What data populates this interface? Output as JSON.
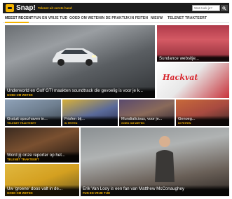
{
  "header": {
    "brand": "Snap!",
    "tagline": "Telenet uit eerste hand",
    "search_placeholder": "Wat zoek je?"
  },
  "nav": {
    "items": [
      {
        "label": "MEEST RECENT",
        "active": true
      },
      {
        "label": "FUN EN VRIJE TIJD",
        "active": false
      },
      {
        "label": "GOED OM WETEN",
        "active": false
      },
      {
        "label": "IN DE PRAKTIJK",
        "active": false
      },
      {
        "label": "IN FEITEN",
        "active": false
      },
      {
        "label": "NIEUW",
        "active": false
      },
      {
        "label": "TELENET TRAKTEERT",
        "active": false
      }
    ]
  },
  "tiles": [
    {
      "title": "Underworld en Golf GTI maakten soundtrack die gevoelig is voor je k...",
      "category": "GOED OM WETEN"
    },
    {
      "title": "Sundance websitje...",
      "category": ""
    },
    {
      "title": "",
      "category": "",
      "logo_text": "Hackvat"
    },
    {
      "title": "Gratuit opscrhaven in...",
      "category": "TELENET TRAKTEERT"
    },
    {
      "title": "Frisfen bij...",
      "category": "IN FEITEN"
    },
    {
      "title": "Mundialicious, voor je...",
      "category": "GOED OM WETEN"
    },
    {
      "title": "Genoeg...",
      "category": "IN FEITEN"
    },
    {
      "title": "Word jij onze reporter op het...",
      "category": "TELENET TRAKTEERT"
    },
    {
      "title": "Erik Van Looy is een fan van Matthew McConaughey",
      "category": "FUN EN VRIJE TIJD"
    },
    {
      "title": "Uw 'groene' doos valt in de...",
      "category": "GOED OM WETEN"
    }
  ],
  "colors": {
    "accent": "#f5b400",
    "topbar": "#1c1c1c"
  }
}
